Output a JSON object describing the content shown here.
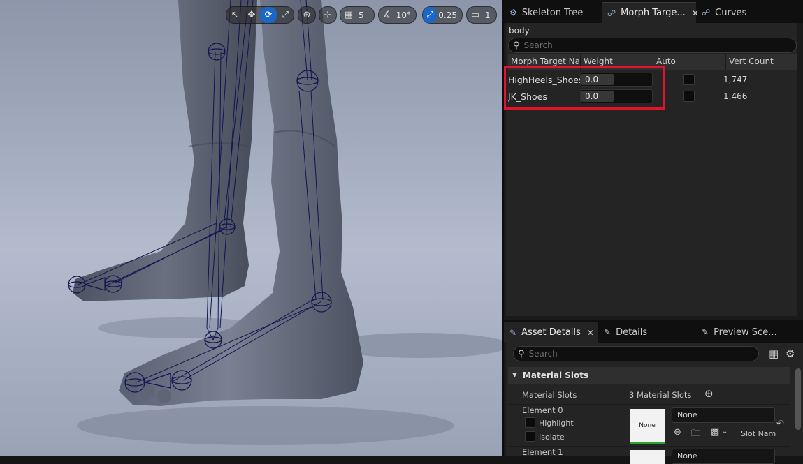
{
  "viewport": {
    "toolbar": {
      "grid_snap_value": "5",
      "rotation_snap_value": "10°",
      "scale_snap_value": "0.25",
      "camera_speed_value": "1"
    }
  },
  "morph_panel": {
    "tabs": [
      {
        "label": "Skeleton Tree",
        "icon": "skeleton-tree-icon"
      },
      {
        "label": "Morph Targe...",
        "icon": "morph-target-icon",
        "active": true
      },
      {
        "label": "Curves",
        "icon": "curves-icon"
      }
    ],
    "mesh_name": "body",
    "search_placeholder": "Search",
    "columns": [
      "Morph Target Na",
      "Weight",
      "Auto",
      "Vert Count"
    ],
    "rows": [
      {
        "name": "HighHeels_Shoes",
        "weight": "0.0",
        "auto": false,
        "vert_count": "1,747"
      },
      {
        "name": "JK_Shoes",
        "weight": "0.0",
        "auto": false,
        "vert_count": "1,466"
      }
    ],
    "highlight_color": "#e3132b"
  },
  "details_panel": {
    "tabs": [
      {
        "label": "Asset Details",
        "icon": "asset-details-icon",
        "active": true
      },
      {
        "label": "Details",
        "icon": "details-icon"
      },
      {
        "label": "Preview Sce...",
        "icon": "preview-scene-icon"
      }
    ],
    "search_placeholder": "Search",
    "section_title": "Material Slots",
    "material_slots_label": "Material Slots",
    "material_slots_value": "3 Material Slots",
    "element0": {
      "label": "Element 0",
      "highlight_label": "Highlight",
      "isolate_label": "Isolate",
      "thumbnail_text": "None",
      "material_value": "None",
      "slot_name_label": "Slot Nam"
    },
    "element1": {
      "label": "Element 1",
      "material_value": "None"
    }
  },
  "colors": {
    "accent_blue": "#1a67c8",
    "panel_bg": "#242424",
    "viewport_bg": "#a9b2c6"
  }
}
